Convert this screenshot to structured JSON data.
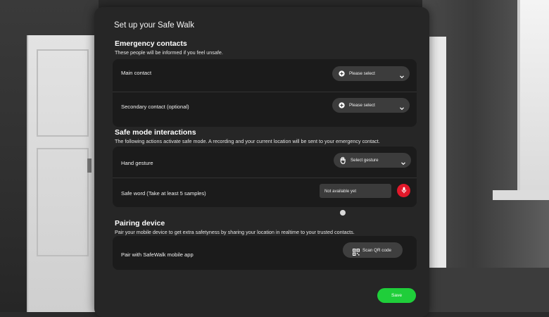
{
  "page": {
    "title": "Set up your Safe Walk"
  },
  "emergency": {
    "title": "Emergency contacts",
    "description": "These people will be informed if you feel unsafe.",
    "rows": [
      {
        "label": "Main contact",
        "select_value": "Please select",
        "icon": "plus-circle-icon"
      },
      {
        "label": "Secondary contact (optional)",
        "select_value": "Please select",
        "icon": "plus-circle-icon"
      }
    ]
  },
  "safe_mode": {
    "title": "Safe mode interactions",
    "description": "The following actions activate safe mode. A recording and your current location will be sent to your emergency contact.",
    "gesture": {
      "label": "Hand gesture",
      "select_value": "Select gesture",
      "icon": "hand-icon"
    },
    "safe_word": {
      "label": "Safe word (Take at least 5 samples)",
      "field_value": "Not available yet",
      "icon": "microphone-icon"
    }
  },
  "pairing": {
    "title": "Pairing device",
    "description": "Pair your mobile device to get extra safetyness by sharing your location in realtime to your trusted contacts.",
    "row": {
      "label": "Pair with SafeWalk mobile app",
      "button": "Scan QR code",
      "icon": "qr-code-icon"
    }
  },
  "footer": {
    "save": "Save"
  },
  "colors": {
    "panel": "#262626",
    "card": "#1b1b1b",
    "control": "#3c3c3c",
    "save_green": "#1fce3a",
    "mic_red": "#e2182a"
  }
}
